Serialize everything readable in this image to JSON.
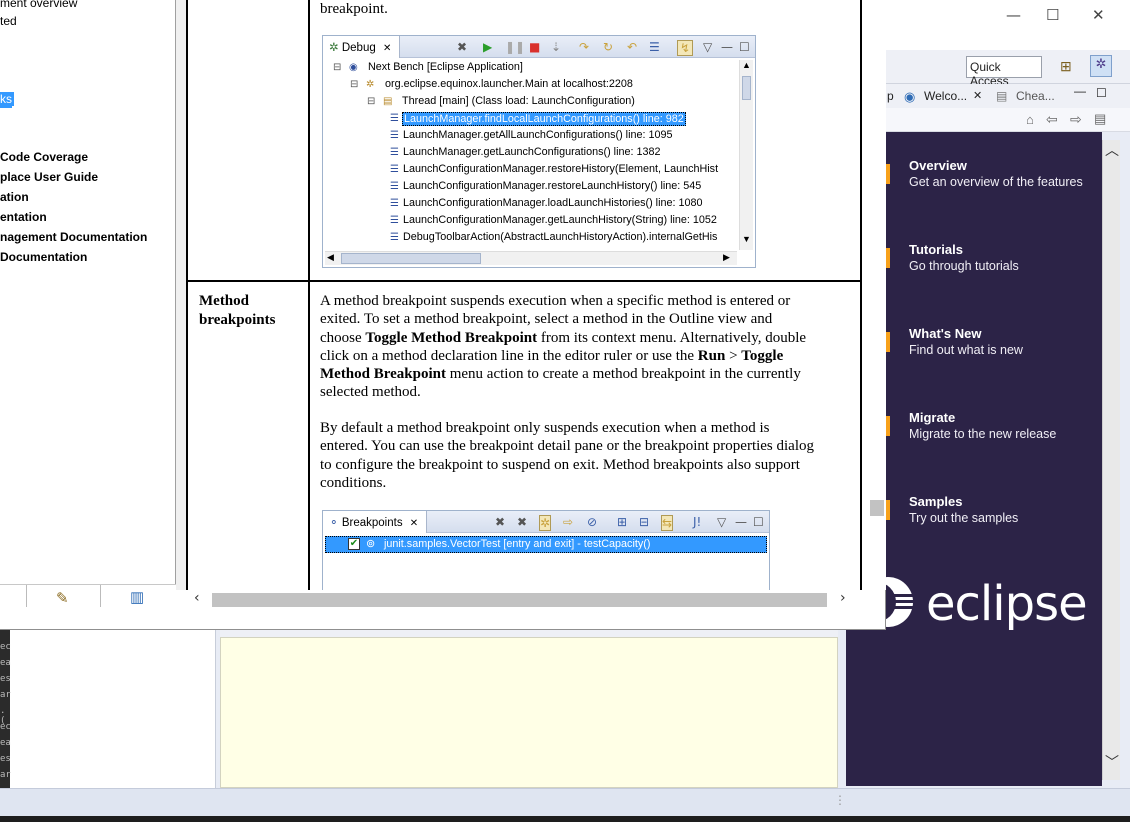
{
  "help_nav": {
    "items": [
      {
        "label": "ment overview",
        "bold": false
      },
      {
        "label": "ted",
        "bold": false
      },
      {
        "label": "ks",
        "bold": false
      },
      {
        "label": "Code Coverage",
        "bold": true
      },
      {
        "label": "place User Guide",
        "bold": true
      },
      {
        "label": "ation",
        "bold": true
      },
      {
        "label": "entation",
        "bold": true
      },
      {
        "label": "nagement Documentation",
        "bold": true
      },
      {
        "label": "Documentation",
        "bold": true
      }
    ]
  },
  "content": {
    "top_text": "breakpoint.",
    "row_header": "Method breakpoints",
    "row_header_1": "Method",
    "row_header_2": "breakpoints",
    "para1": [
      "A method breakpoint suspends execution when a specific method is entered or",
      "exited. To set a method breakpoint, select a method in the Outline view and",
      "choose |Toggle Method Breakpoint| from its context menu. Alternatively, double",
      "click on a method declaration line in the editor ruler or use the |Run| > |Toggle",
      "|Method Breakpoint| menu action to create a method breakpoint in the currently",
      "selected method."
    ],
    "para2": [
      "By default a method breakpoint only suspends execution when a method is",
      "entered. You can use the breakpoint detail pane or the breakpoint properties dialog",
      "to configure the breakpoint to suspend on exit. Method breakpoints also support",
      "conditions."
    ]
  },
  "debug_shot": {
    "tab_label": "Debug",
    "tree": [
      {
        "label": "Next Bench [Eclipse Application]",
        "indent": 0,
        "kind": "app"
      },
      {
        "label": "org.eclipse.equinox.launcher.Main at localhost:2208",
        "indent": 1,
        "kind": "target"
      },
      {
        "label": "Thread [main] (Class load: LaunchConfiguration)",
        "indent": 2,
        "kind": "thread"
      },
      {
        "label": "LaunchManager.findLocalLaunchConfigurations() line: 982",
        "indent": 3,
        "kind": "frame",
        "selected": true
      },
      {
        "label": "LaunchManager.getAllLaunchConfigurations() line: 1095",
        "indent": 3,
        "kind": "frame"
      },
      {
        "label": "LaunchManager.getLaunchConfigurations() line: 1382",
        "indent": 3,
        "kind": "frame"
      },
      {
        "label": "LaunchConfigurationManager.restoreHistory(Element, LaunchHist",
        "indent": 3,
        "kind": "frame"
      },
      {
        "label": "LaunchConfigurationManager.restoreLaunchHistory() line: 545",
        "indent": 3,
        "kind": "frame"
      },
      {
        "label": "LaunchConfigurationManager.loadLaunchHistories() line: 1080",
        "indent": 3,
        "kind": "frame"
      },
      {
        "label": "LaunchConfigurationManager.getLaunchHistory(String) line: 1052",
        "indent": 3,
        "kind": "frame"
      },
      {
        "label": "DebugToolbarAction(AbstractLaunchHistoryAction).internalGetHis",
        "indent": 3,
        "kind": "frame"
      }
    ]
  },
  "breakpoints_shot": {
    "tab_label": "Breakpoints",
    "item_label": "junit.samples.VectorTest [entry and exit] - testCapacity()"
  },
  "right_window": {
    "quick_access": "Quick Access",
    "tabs": [
      "p",
      "Welco...",
      "Chea..."
    ],
    "welcome_items": [
      {
        "title": "Overview",
        "desc": "Get an overview of the features"
      },
      {
        "title": "Tutorials",
        "desc": "Go through tutorials"
      },
      {
        "title": "What's New",
        "desc": "Find out what is new"
      },
      {
        "title": "Migrate",
        "desc": "Migrate to the new release"
      },
      {
        "title": "Samples",
        "desc": "Try out the samples"
      }
    ],
    "brand": "eclipse",
    "accent": "#f7a11a",
    "welcome_bg": "#2c2347"
  },
  "bg_left_glyphs": [
    "ec",
    "ea",
    "es",
    "ar",
    ".(",
    "ec",
    "ea",
    "es",
    "ar"
  ]
}
